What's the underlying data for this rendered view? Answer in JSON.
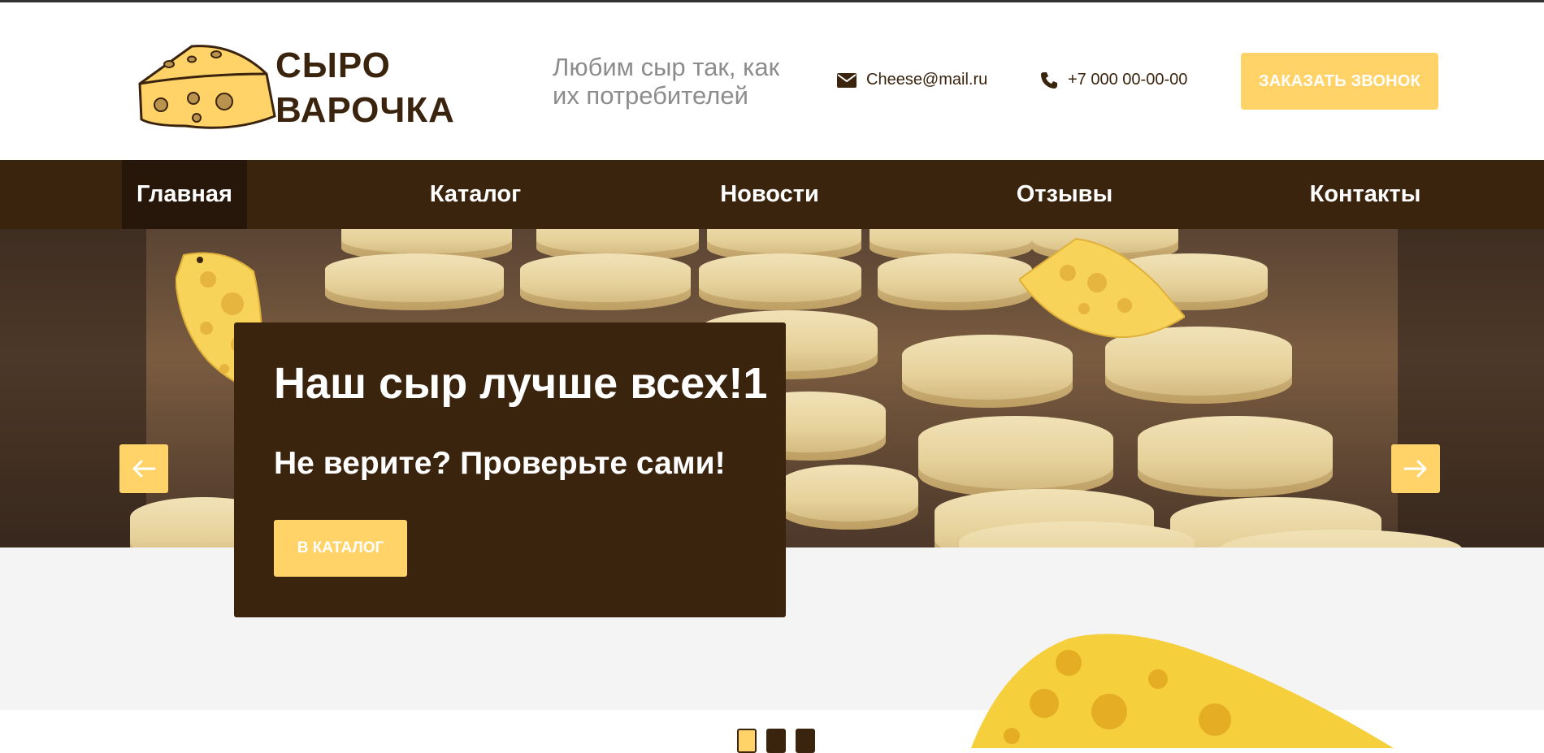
{
  "header": {
    "logo_line1": "СЫРО",
    "logo_line2": "ВАРОЧКА",
    "tagline": "Любим сыр так, как их потребителей",
    "email": "Cheese@mail.ru",
    "phone": "+7 000 00-00-00",
    "call_button": "ЗАКАЗАТЬ ЗВОНОК",
    "icons": {
      "email": "envelope-icon",
      "phone": "phone-icon"
    }
  },
  "nav": {
    "items": [
      {
        "label": "Главная",
        "active": true
      },
      {
        "label": "Каталог",
        "active": false
      },
      {
        "label": "Новости",
        "active": false
      },
      {
        "label": "Отзывы",
        "active": false
      },
      {
        "label": "Контакты",
        "active": false
      }
    ]
  },
  "hero": {
    "title": "Наш сыр лучше всех!1",
    "subtitle": "Не верите? Проверьте сами!",
    "button": "В КАТАЛОГ",
    "arrows": {
      "prev": "arrow-left-icon",
      "next": "arrow-right-icon"
    },
    "slides_total": 3,
    "active_slide": 1
  },
  "colors": {
    "brown": "#3b240e",
    "brown_dark": "#26170a",
    "yellow": "#ffd367",
    "gray_text": "#8c8c8c",
    "band": "#f4f4f4"
  }
}
